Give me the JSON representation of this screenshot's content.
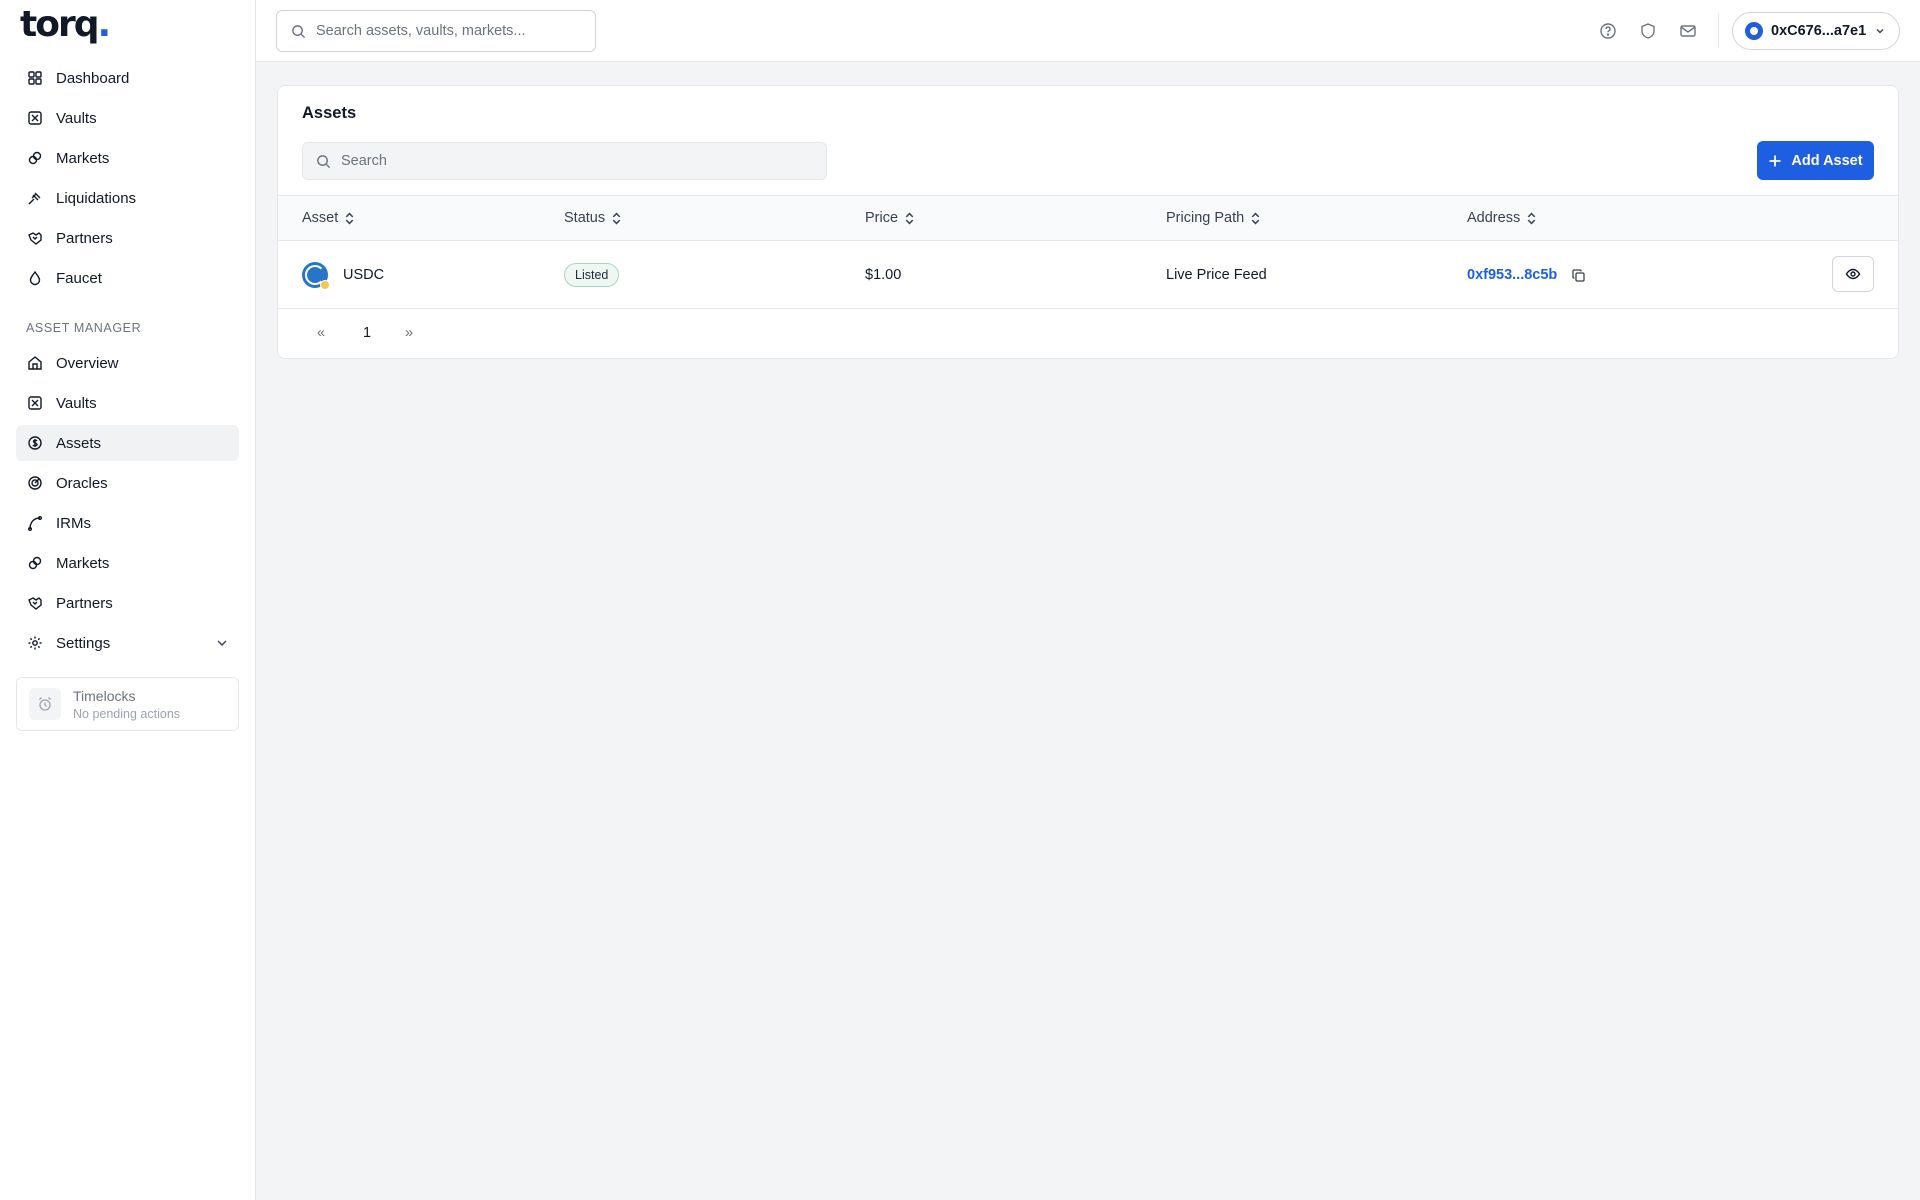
{
  "brand": {
    "name": "torq",
    "dot": "."
  },
  "sidebar": {
    "main_items": [
      {
        "label": "Dashboard",
        "icon": "grid-icon"
      },
      {
        "label": "Vaults",
        "icon": "vault-icon"
      },
      {
        "label": "Markets",
        "icon": "link-icon"
      },
      {
        "label": "Liquidations",
        "icon": "gavel-icon"
      },
      {
        "label": "Partners",
        "icon": "handshake-icon"
      },
      {
        "label": "Faucet",
        "icon": "droplet-icon"
      }
    ],
    "section_label": "ASSET MANAGER",
    "manager_items": [
      {
        "label": "Overview",
        "icon": "home-icon"
      },
      {
        "label": "Vaults",
        "icon": "vault-icon"
      },
      {
        "label": "Assets",
        "icon": "dollar-circle-icon",
        "active": true
      },
      {
        "label": "Oracles",
        "icon": "radar-icon"
      },
      {
        "label": "IRMs",
        "icon": "curve-icon"
      },
      {
        "label": "Markets",
        "icon": "link-icon"
      },
      {
        "label": "Partners",
        "icon": "handshake-icon"
      },
      {
        "label": "Settings",
        "icon": "gear-icon"
      }
    ],
    "timelocks": {
      "title": "Timelocks",
      "subtitle": "No pending actions"
    }
  },
  "topbar": {
    "search_placeholder": "Search assets, vaults, markets...",
    "wallet": "0xC676...a7e1"
  },
  "assets": {
    "title": "Assets",
    "search_placeholder": "Search",
    "add_label": "Add Asset",
    "columns": [
      "Asset",
      "Status",
      "Price",
      "Pricing Path",
      "Address"
    ],
    "rows": [
      {
        "asset": "USDC",
        "status": "Listed",
        "price": "$1.00",
        "pricing_path": "Live Price Feed",
        "address": "0xf953...8c5b"
      }
    ],
    "pagination": {
      "prev": "«",
      "page": "1",
      "next": "»"
    }
  },
  "colors": {
    "accent": "#1d5fe0",
    "usdc": "#2775ca",
    "active_bg": "#f1f2f4"
  }
}
